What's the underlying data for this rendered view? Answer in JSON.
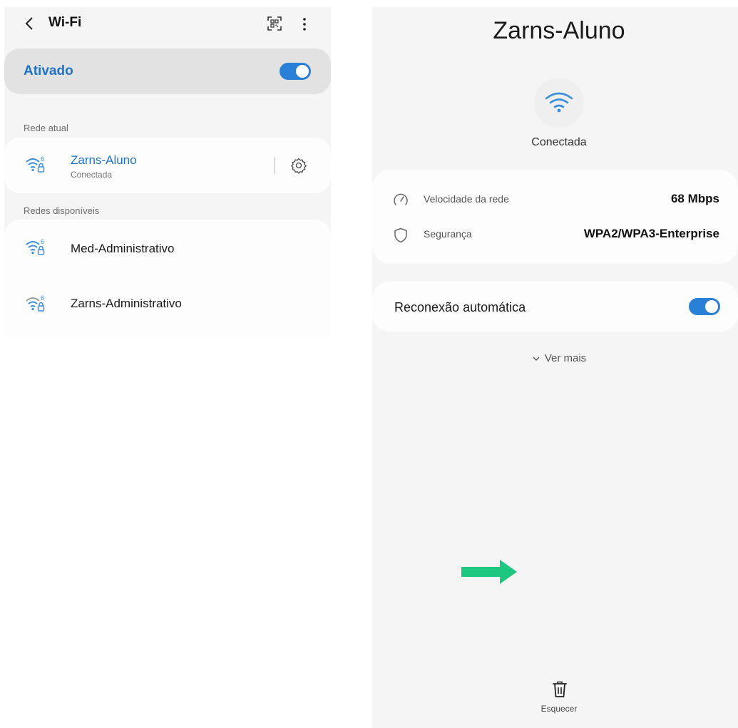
{
  "left": {
    "header": {
      "title": "Wi-Fi",
      "icons": [
        "back-icon",
        "qr-code-icon",
        "more-vert-icon"
      ]
    },
    "wifi_toggle": {
      "label": "Ativado",
      "on": true
    },
    "current_section": "Rede atual",
    "current_network": {
      "name": "Zarns-Aluno",
      "status": "Conectada",
      "icon": "wifi-6-lock-icon"
    },
    "available_section": "Redes disponíveis",
    "available_networks": [
      {
        "name": "Med-Administrativo",
        "icon": "wifi-6-lock-icon"
      },
      {
        "name": "Zarns-Administrativo",
        "icon": "wifi-6-lock-icon"
      }
    ]
  },
  "right": {
    "title": "Zarns-Aluno",
    "status": "Conectada",
    "info": [
      {
        "label": "Velocidade da rede",
        "value": "68 Mbps",
        "icon": "speedometer-icon"
      },
      {
        "label": "Segurança",
        "value": "WPA2/WPA3-Enterprise",
        "icon": "shield-icon"
      }
    ],
    "auto_reconnect": {
      "label": "Reconexão automática",
      "on": true
    },
    "see_more": "Ver mais",
    "forget": "Esquecer"
  },
  "colors": {
    "accent": "#1e73c8",
    "switch": "#2a7fd6",
    "wifi_active": "#3a8ee0",
    "wifi_inactive": "#9a9a9a",
    "arrow": "#1ec77f",
    "panel_bg": "#f5f5f5",
    "card_bg": "#fdfdfd"
  }
}
